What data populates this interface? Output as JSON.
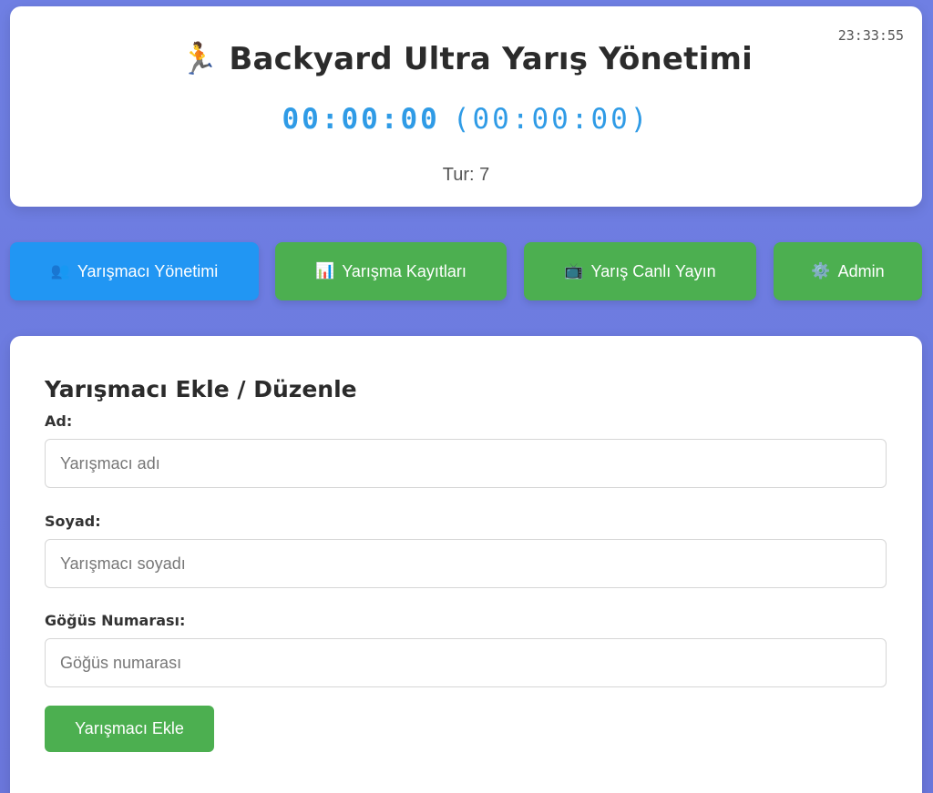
{
  "header": {
    "clock": "23:33:55",
    "title_icon": "🏃",
    "title": "Backyard Ultra Yarış Yönetimi",
    "timer_main": "00:00:00",
    "timer_sub": "(00:00:00)",
    "round": "Tur: 7"
  },
  "nav": {
    "items": [
      {
        "icon": "👥",
        "icon_name": "users-icon",
        "label": "Yarışmacı Yönetimi",
        "active": true
      },
      {
        "icon": "📊",
        "icon_name": "bar-chart-icon",
        "label": "Yarışma Kayıtları",
        "active": false
      },
      {
        "icon": "📺",
        "icon_name": "tv-icon",
        "label": "Yarış Canlı Yayın",
        "active": false
      },
      {
        "icon": "⚙️",
        "icon_name": "gear-icon",
        "label": "Admin",
        "active": false
      }
    ],
    "colors": {
      "active": "#2196f3",
      "inactive": "#4caf50"
    }
  },
  "form": {
    "title": "Yarışmacı Ekle / Düzenle",
    "fields": [
      {
        "label": "Ad:",
        "placeholder": "Yarışmacı adı",
        "value": ""
      },
      {
        "label": "Soyad:",
        "placeholder": "Yarışmacı soyadı",
        "value": ""
      },
      {
        "label": "Göğüs Numarası:",
        "placeholder": "Göğüs numarası",
        "value": ""
      }
    ],
    "submit_label": "Yarışmacı Ekle"
  }
}
